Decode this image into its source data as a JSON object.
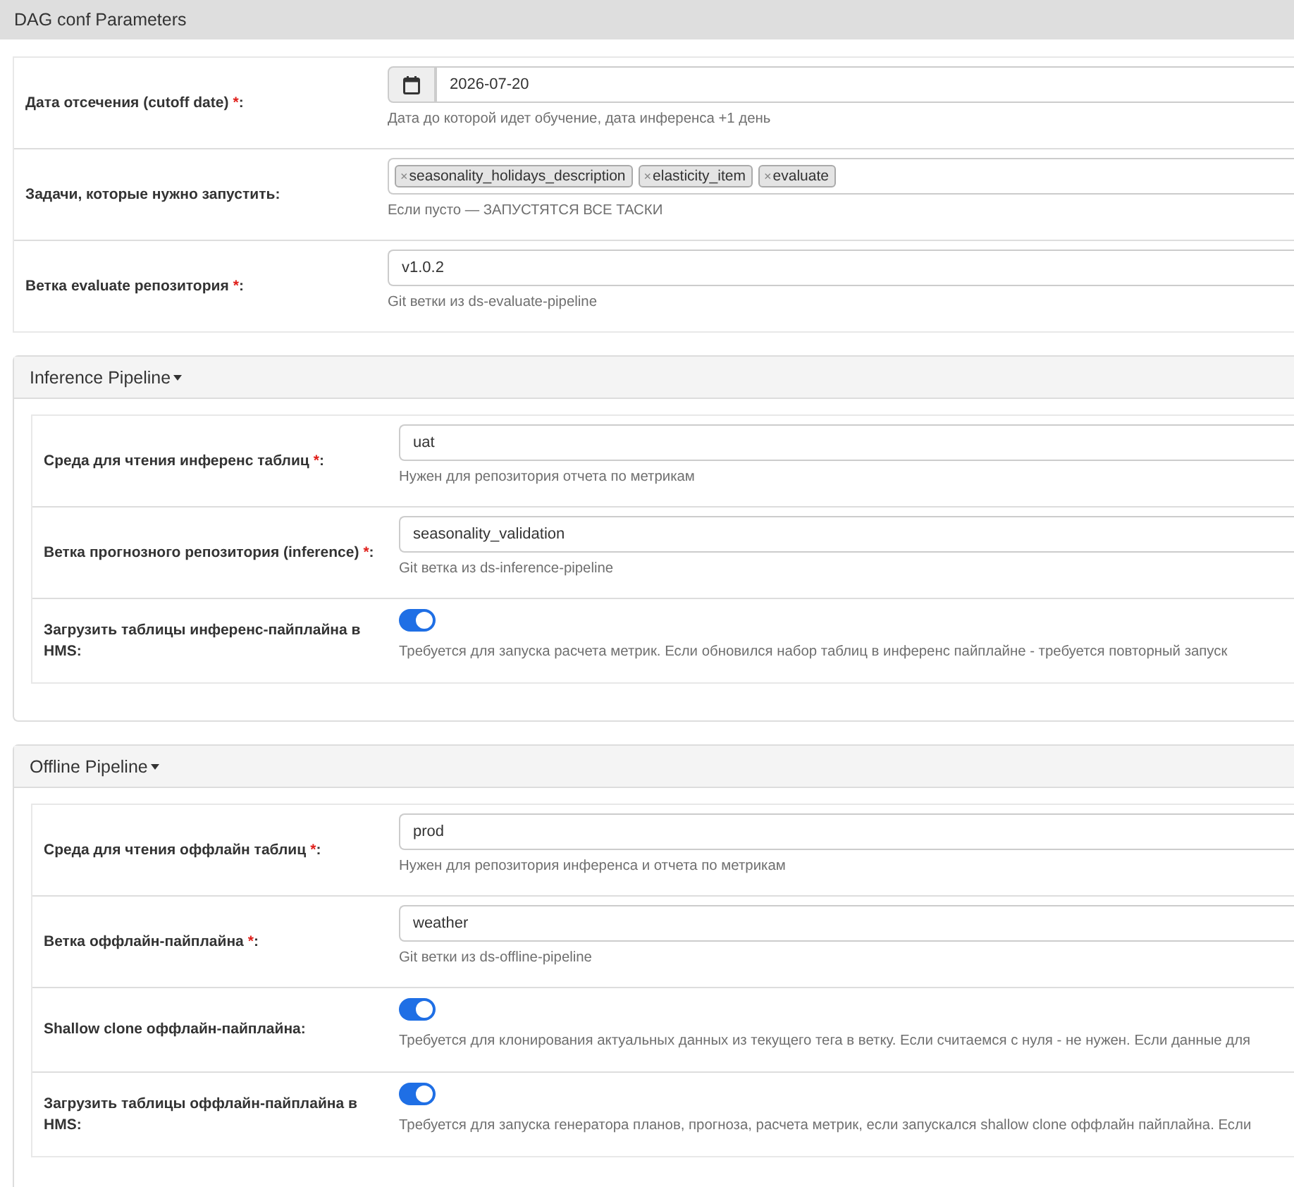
{
  "header": {
    "title": "DAG conf Parameters"
  },
  "main_fields": [
    {
      "kind": "date",
      "label": "Дата отсечения (cutoff date)",
      "required_mark": "*",
      "label_suffix": ":",
      "value": "2026-07-20",
      "help": "Дата до которой идет обучение, дата инференса +1 день"
    },
    {
      "kind": "tags",
      "label": "Задачи, которые нужно запустить",
      "label_suffix": ":",
      "tags": [
        {
          "remove": "×",
          "label": "seasonality_holidays_description"
        },
        {
          "remove": "×",
          "label": "elasticity_item"
        },
        {
          "remove": "×",
          "label": "evaluate"
        }
      ],
      "help": "Если пусто — ЗАПУСТЯТСЯ ВСЕ ТАСКИ"
    },
    {
      "kind": "text",
      "label": "Ветка evaluate репозитория",
      "required_mark": "*",
      "label_suffix": ":",
      "value": "v1.0.2",
      "help": "Git ветки из ds-evaluate-pipeline"
    }
  ],
  "panels": [
    {
      "title": "Inference Pipeline",
      "expanded": true,
      "fields": [
        {
          "kind": "text",
          "label": "Среда для чтения инференс таблиц",
          "required_mark": "*",
          "label_suffix": ":",
          "value": "uat",
          "help": "Нужен для репозитория отчета по метрикам"
        },
        {
          "kind": "text",
          "label": "Ветка прогнозного репозитория (inference)",
          "required_mark": "*",
          "label_suffix": ":",
          "value": "seasonality_validation",
          "help": "Git ветка из ds-inference-pipeline"
        },
        {
          "kind": "toggle",
          "label": "Загрузить таблицы инференс-пайплайна в HMS",
          "label_suffix": ":",
          "on": true,
          "help": "Требуется для запуска расчета метрик. Если обновился набор таблиц в инференс пайплайне - требуется повторный запуск"
        }
      ]
    },
    {
      "title": "Offline Pipeline",
      "expanded": true,
      "fields": [
        {
          "kind": "text",
          "label": "Среда для чтения оффлайн таблиц",
          "required_mark": "*",
          "label_suffix": ":",
          "value": "prod",
          "help": "Нужен для репозитория инференса и отчета по метрикам"
        },
        {
          "kind": "text",
          "label": "Ветка оффлайн-пайплайна",
          "required_mark": "*",
          "label_suffix": ":",
          "value": "weather",
          "help": "Git ветки из ds-offline-pipeline"
        },
        {
          "kind": "toggle",
          "label": "Shallow clone оффлайн-пайплайна",
          "label_suffix": ":",
          "on": true,
          "help": "Требуется для клонирования актуальных данных из текущего тега в ветку. Если считаемся с нуля - не нужен. Если данные для"
        },
        {
          "kind": "toggle",
          "label": "Загрузить таблицы оффлайн-пайплайна в HMS",
          "label_suffix": ":",
          "on": true,
          "help": "Требуется для запуска генератора планов, прогноза, расчета метрик, если запускался shallow clone оффлайн пайплайна. Если"
        }
      ]
    }
  ]
}
